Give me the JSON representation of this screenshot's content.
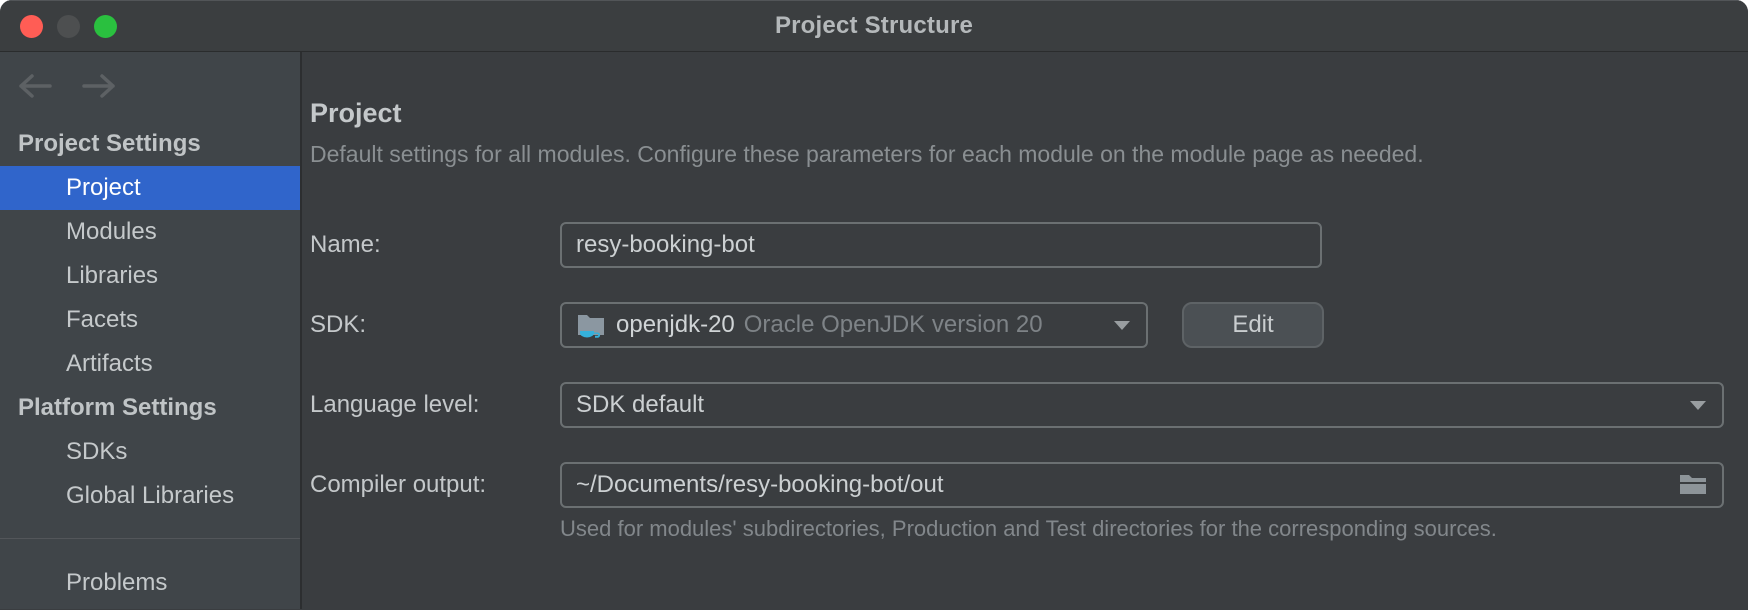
{
  "window": {
    "title": "Project Structure"
  },
  "colors": {
    "selection_blue": "#3065cb",
    "sidebar_bg": "#404549",
    "main_bg": "#3a3d40",
    "titlebar_bg": "#3b3e40",
    "traffic_red": "#ff5d55",
    "traffic_grey": "#4d4f50",
    "traffic_green": "#2ac03f",
    "field_border": "#6b7072",
    "jdk_folder": "#8b97a1",
    "jdk_cup": "#35b1dc"
  },
  "sidebar": {
    "items": [
      {
        "label": "Project Settings",
        "type": "header"
      },
      {
        "label": "Project",
        "type": "item",
        "selected": true
      },
      {
        "label": "Modules",
        "type": "item"
      },
      {
        "label": "Libraries",
        "type": "item"
      },
      {
        "label": "Facets",
        "type": "item"
      },
      {
        "label": "Artifacts",
        "type": "item"
      },
      {
        "label": "Platform Settings",
        "type": "header"
      },
      {
        "label": "SDKs",
        "type": "item"
      },
      {
        "label": "Global Libraries",
        "type": "item"
      },
      {
        "label": "Problems",
        "type": "item"
      }
    ]
  },
  "main": {
    "heading": "Project",
    "description": "Default settings for all modules. Configure these parameters for each module on the module page as needed.",
    "fields": {
      "name": {
        "label": "Name:",
        "value": "resy-booking-bot"
      },
      "sdk": {
        "label": "SDK:",
        "value_primary": "openjdk-20",
        "value_secondary": "Oracle OpenJDK version 20",
        "edit_button": "Edit"
      },
      "language_level": {
        "label": "Language level:",
        "value": "SDK default"
      },
      "compiler_output": {
        "label": "Compiler output:",
        "value": "~/Documents/resy-booking-bot/out",
        "help": "Used for modules' subdirectories, Production and Test directories for the corresponding sources."
      }
    }
  }
}
